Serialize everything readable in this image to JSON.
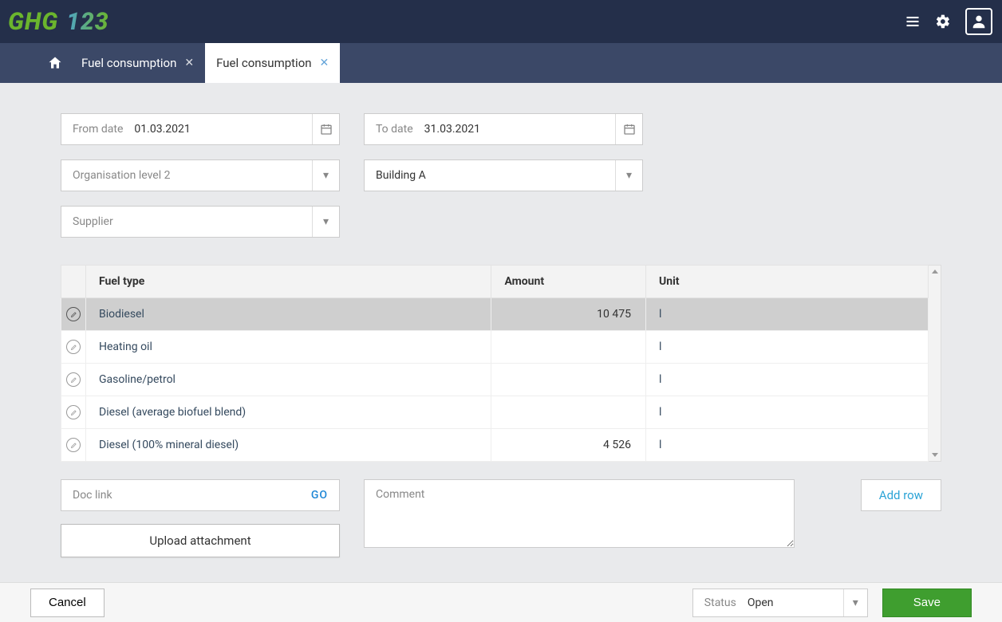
{
  "header": {
    "logo_part1": "GHG",
    "logo_part2": "123"
  },
  "tabs": [
    {
      "label": "Fuel consumption",
      "active": false
    },
    {
      "label": "Fuel consumption",
      "active": true
    }
  ],
  "form": {
    "from_date": {
      "label": "From date",
      "value": "01.03.2021"
    },
    "to_date": {
      "label": "To date",
      "value": "31.03.2021"
    },
    "org_level": {
      "placeholder": "Organisation level 2",
      "value": ""
    },
    "building": {
      "placeholder": "",
      "value": "Building A"
    },
    "supplier": {
      "placeholder": "Supplier",
      "value": ""
    }
  },
  "table": {
    "headers": {
      "fuel_type": "Fuel type",
      "amount": "Amount",
      "unit": "Unit"
    },
    "rows": [
      {
        "fuel_type": "Biodiesel",
        "amount": "10 475",
        "unit": "l",
        "selected": true
      },
      {
        "fuel_type": "Heating oil",
        "amount": "",
        "unit": "l",
        "selected": false
      },
      {
        "fuel_type": "Gasoline/petrol",
        "amount": "",
        "unit": "l",
        "selected": false
      },
      {
        "fuel_type": "Diesel (average biofuel blend)",
        "amount": "",
        "unit": "l",
        "selected": false
      },
      {
        "fuel_type": "Diesel (100% mineral diesel)",
        "amount": "4 526",
        "unit": "l",
        "selected": false
      }
    ]
  },
  "controls": {
    "doc_link_label": "Doc link",
    "doc_link_go": "GO",
    "upload_label": "Upload attachment",
    "comment_placeholder": "Comment",
    "add_row_label": "Add row"
  },
  "footer": {
    "cancel": "Cancel",
    "status_label": "Status",
    "status_value": "Open",
    "save": "Save"
  }
}
